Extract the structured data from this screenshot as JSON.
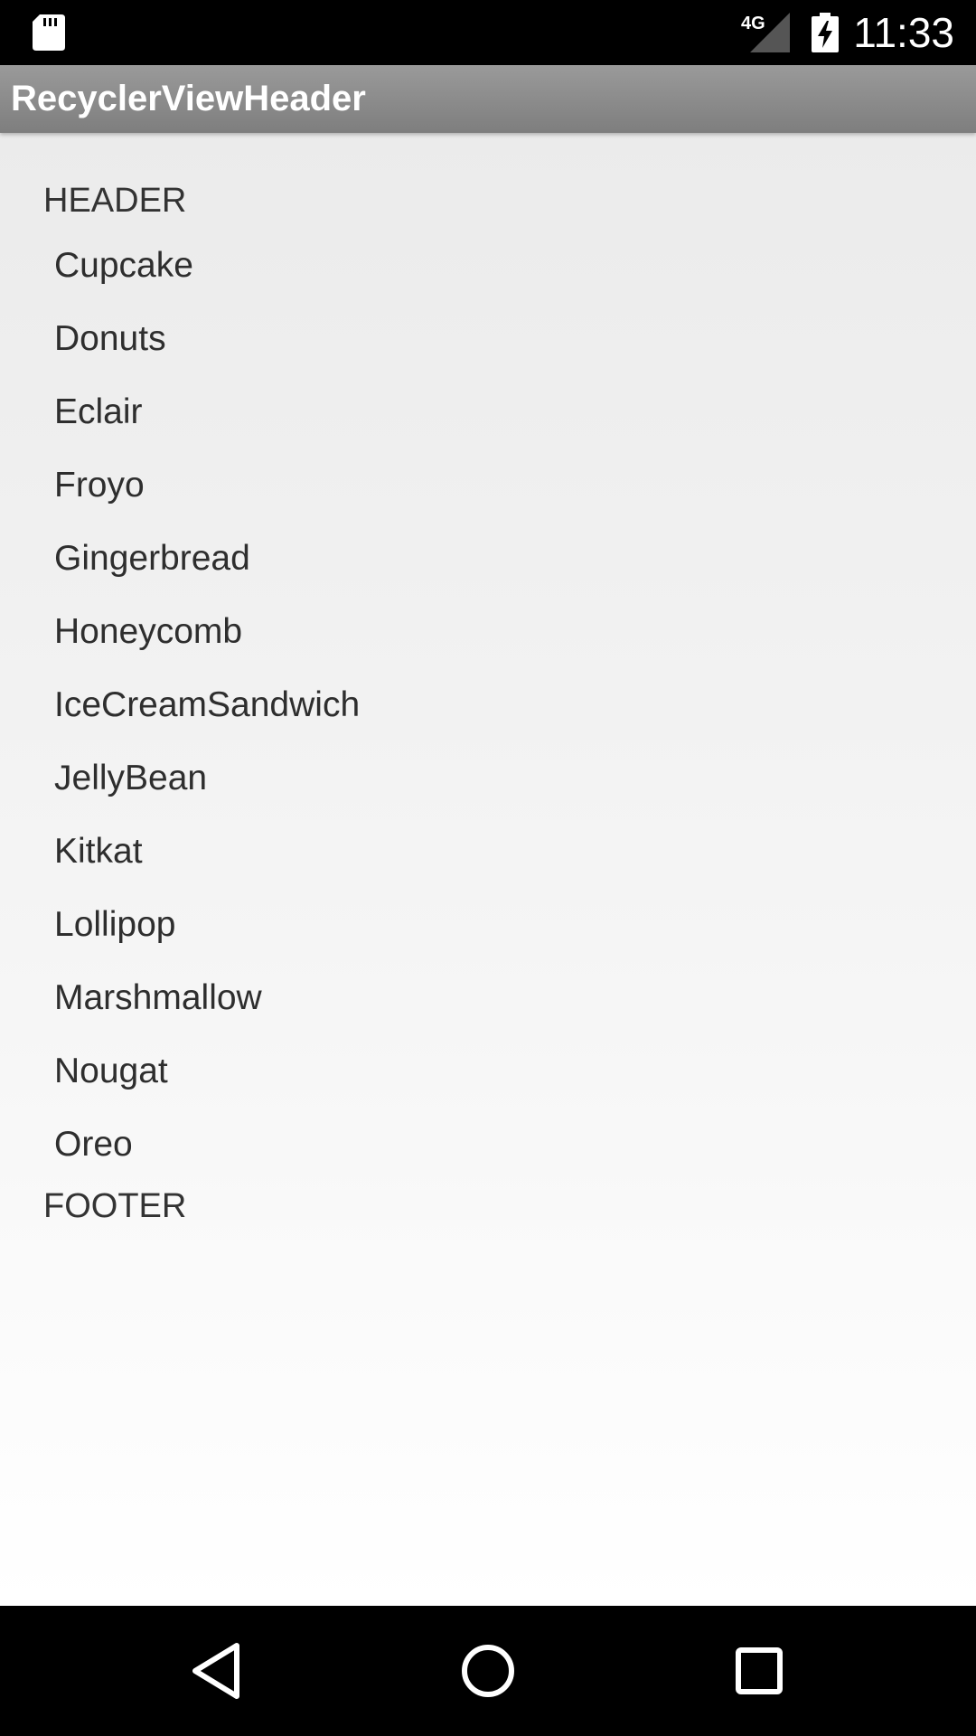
{
  "status_bar": {
    "time": "11:33",
    "network": "4G",
    "icons": [
      "sd-card-icon",
      "signal-icon",
      "battery-charging-icon"
    ]
  },
  "app_bar": {
    "title": "RecyclerViewHeader"
  },
  "content": {
    "header": "HEADER",
    "items": [
      {
        "label": "Cupcake"
      },
      {
        "label": "Donuts"
      },
      {
        "label": "Eclair"
      },
      {
        "label": "Froyo"
      },
      {
        "label": "Gingerbread"
      },
      {
        "label": "Honeycomb"
      },
      {
        "label": "IceCreamSandwich"
      },
      {
        "label": "JellyBean"
      },
      {
        "label": "Kitkat"
      },
      {
        "label": "Lollipop"
      },
      {
        "label": "Marshmallow"
      },
      {
        "label": "Nougat"
      },
      {
        "label": "Oreo"
      }
    ],
    "footer": "FOOTER"
  },
  "nav_bar": {
    "icons": [
      "back-icon",
      "home-icon",
      "recents-icon"
    ]
  }
}
